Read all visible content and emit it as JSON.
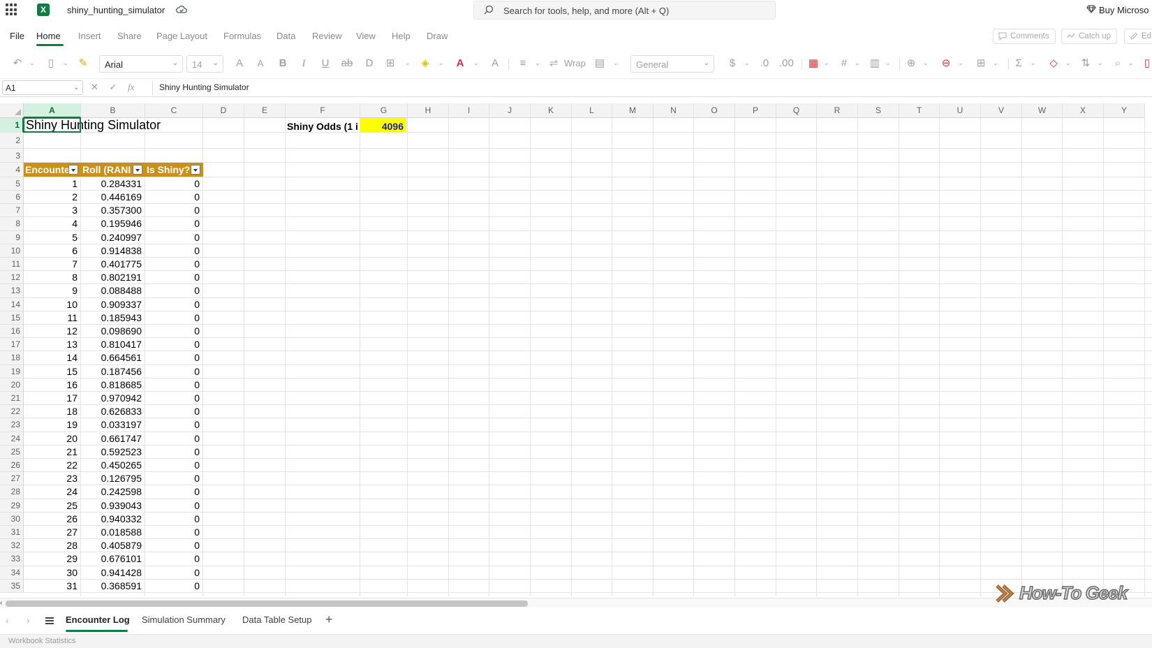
{
  "app": {
    "filename": "shiny_hunting_simulator",
    "search_placeholder": "Search for tools, help, and more (Alt + Q)",
    "buy_label": "Buy Microso"
  },
  "menu": {
    "file": "File",
    "tabs": [
      "Home",
      "Insert",
      "Share",
      "Page Layout",
      "Formulas",
      "Data",
      "Review",
      "View",
      "Help",
      "Draw"
    ],
    "active_tab": "Home",
    "comments": "Comments",
    "catch_up": "Catch up",
    "edit": "Ed"
  },
  "ribbon": {
    "font_name": "Arial",
    "font_size": "14",
    "wrap_label": "Wrap",
    "number_format": "General"
  },
  "formula_bar": {
    "name_box": "A1",
    "fx_label": "fx",
    "formula": "Shiny Hunting Simulator"
  },
  "grid": {
    "columns": [
      "A",
      "B",
      "C",
      "D",
      "E",
      "F",
      "G",
      "H",
      "I",
      "J",
      "K",
      "L",
      "M",
      "N",
      "O",
      "P",
      "Q",
      "R",
      "S",
      "T",
      "U",
      "V",
      "W",
      "X",
      "Y"
    ],
    "rows": [
      "1",
      "2",
      "3",
      "4",
      "5",
      "6",
      "7",
      "8",
      "9",
      "10",
      "11",
      "12",
      "13",
      "14",
      "15",
      "16",
      "17",
      "18",
      "19",
      "20",
      "21",
      "22",
      "23",
      "24",
      "25",
      "26",
      "27",
      "28",
      "29",
      "30",
      "31",
      "32",
      "33",
      "34",
      "35"
    ],
    "selected_cell": "A1",
    "title": "Shiny Hunting Simulator",
    "odds_label": "Shiny Odds (1 i",
    "odds_value": "4096",
    "table_headers": [
      "Encounte",
      "Roll (RANI",
      "Is Shiny?"
    ],
    "table_rows": [
      [
        "1",
        "0.284331",
        "0"
      ],
      [
        "2",
        "0.446169",
        "0"
      ],
      [
        "3",
        "0.357300",
        "0"
      ],
      [
        "4",
        "0.195946",
        "0"
      ],
      [
        "5",
        "0.240997",
        "0"
      ],
      [
        "6",
        "0.914838",
        "0"
      ],
      [
        "7",
        "0.401775",
        "0"
      ],
      [
        "8",
        "0.802191",
        "0"
      ],
      [
        "9",
        "0.088488",
        "0"
      ],
      [
        "10",
        "0.909337",
        "0"
      ],
      [
        "11",
        "0.185943",
        "0"
      ],
      [
        "12",
        "0.098690",
        "0"
      ],
      [
        "13",
        "0.810417",
        "0"
      ],
      [
        "14",
        "0.664561",
        "0"
      ],
      [
        "15",
        "0.187456",
        "0"
      ],
      [
        "16",
        "0.818685",
        "0"
      ],
      [
        "17",
        "0.970942",
        "0"
      ],
      [
        "18",
        "0.626833",
        "0"
      ],
      [
        "19",
        "0.033197",
        "0"
      ],
      [
        "20",
        "0.661747",
        "0"
      ],
      [
        "21",
        "0.592523",
        "0"
      ],
      [
        "22",
        "0.450265",
        "0"
      ],
      [
        "23",
        "0.126795",
        "0"
      ],
      [
        "24",
        "0.242598",
        "0"
      ],
      [
        "25",
        "0.939043",
        "0"
      ],
      [
        "26",
        "0.940332",
        "0"
      ],
      [
        "27",
        "0.018588",
        "0"
      ],
      [
        "28",
        "0.405879",
        "0"
      ],
      [
        "29",
        "0.676101",
        "0"
      ],
      [
        "30",
        "0.941428",
        "0"
      ],
      [
        "31",
        "0.368591",
        "0"
      ]
    ]
  },
  "sheet_tabs": [
    "Encounter Log",
    "Simulation Summary",
    "Data Table Setup"
  ],
  "active_sheet": "Encounter Log",
  "status": {
    "text": "Workbook Statistics"
  },
  "watermark": "How-To Geek",
  "colors": {
    "accent": "#107c41",
    "table_header": "#c8901c",
    "odds_fill": "#ffff00"
  }
}
